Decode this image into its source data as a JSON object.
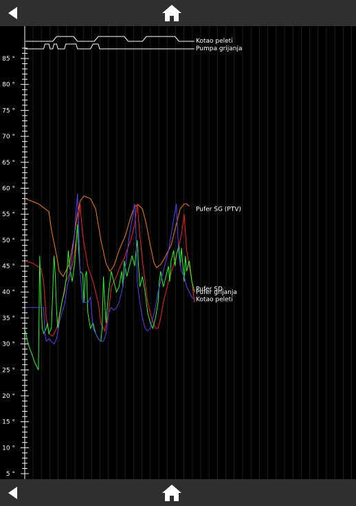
{
  "nav": {
    "back_icon": "back-arrow-icon",
    "home_icon": "home-icon"
  },
  "chart_data": {
    "type": "line",
    "ylim": [
      4,
      90
    ],
    "xlim": [
      0,
      100
    ],
    "yticks": [
      5,
      10,
      15,
      20,
      25,
      30,
      35,
      40,
      45,
      50,
      55,
      60,
      65,
      70,
      75,
      80,
      85
    ],
    "ytick_suffix": " °",
    "grid": "vertical",
    "series": [
      {
        "name": "Pufer SG (PTV)",
        "color": "#ff7f00",
        "label_at": 56,
        "points": [
          [
            0,
            58
          ],
          [
            5,
            57
          ],
          [
            9,
            55.5
          ],
          [
            10,
            52
          ],
          [
            12,
            47
          ],
          [
            13,
            44
          ],
          [
            14.5,
            43
          ],
          [
            15.5,
            44
          ],
          [
            17,
            45.5
          ],
          [
            18.5,
            50
          ],
          [
            20,
            55
          ],
          [
            21,
            57.5
          ],
          [
            22.5,
            58.5
          ],
          [
            25,
            58
          ],
          [
            27,
            56
          ],
          [
            29,
            50
          ],
          [
            31,
            45.5
          ],
          [
            32.5,
            44
          ],
          [
            34,
            45
          ],
          [
            36,
            48
          ],
          [
            38.5,
            51
          ],
          [
            40.5,
            54.5
          ],
          [
            42,
            56.5
          ],
          [
            43.5,
            56.8
          ],
          [
            45,
            56
          ],
          [
            46.5,
            53
          ],
          [
            48,
            49
          ],
          [
            49.5,
            45.5
          ],
          [
            50.5,
            44.7
          ],
          [
            52,
            45.3
          ],
          [
            54,
            47
          ],
          [
            56,
            49
          ],
          [
            58,
            53
          ],
          [
            59.5,
            56
          ],
          [
            61,
            57
          ],
          [
            62,
            57
          ],
          [
            63,
            56.5
          ]
        ]
      },
      {
        "name": "Pufer SD",
        "color": "#ff2020",
        "label_at": 40.6,
        "points": [
          [
            0,
            46
          ],
          [
            3,
            45.5
          ],
          [
            6,
            44.5
          ],
          [
            7,
            42
          ],
          [
            8,
            35
          ],
          [
            9,
            32
          ],
          [
            10.5,
            31.5
          ],
          [
            12,
            33
          ],
          [
            14,
            38
          ],
          [
            15.5,
            42
          ],
          [
            17,
            43.5
          ],
          [
            18.5,
            46
          ],
          [
            20,
            52
          ],
          [
            21,
            57
          ],
          [
            22,
            51
          ],
          [
            23,
            48
          ],
          [
            24,
            45
          ],
          [
            26,
            42
          ],
          [
            28,
            38
          ],
          [
            29,
            34
          ],
          [
            30.5,
            32.5
          ],
          [
            32,
            36
          ],
          [
            33,
            41
          ],
          [
            35,
            43
          ],
          [
            36.5,
            45
          ],
          [
            38,
            46.5
          ],
          [
            39,
            48
          ],
          [
            40.5,
            50
          ],
          [
            42,
            53
          ],
          [
            43,
            57
          ],
          [
            44,
            51
          ],
          [
            45,
            46
          ],
          [
            46,
            42
          ],
          [
            47,
            38
          ],
          [
            48.5,
            35
          ],
          [
            50,
            33
          ],
          [
            51,
            33
          ],
          [
            52,
            35
          ],
          [
            53,
            38
          ],
          [
            55,
            42
          ],
          [
            56.5,
            44.5
          ],
          [
            58,
            47
          ],
          [
            59,
            49
          ],
          [
            60,
            51
          ],
          [
            61,
            55
          ],
          [
            62,
            48
          ],
          [
            63,
            45
          ],
          [
            64,
            42
          ],
          [
            65,
            38
          ]
        ]
      },
      {
        "name": "Pufer grijanja",
        "color": "#20ff20",
        "label_at": 40,
        "points": [
          [
            0,
            32.5
          ],
          [
            1,
            30
          ],
          [
            2.5,
            28
          ],
          [
            3.5,
            26.5
          ],
          [
            5,
            25
          ],
          [
            5.5,
            47
          ],
          [
            6,
            38
          ],
          [
            6.5,
            33
          ],
          [
            7,
            32
          ],
          [
            8,
            33
          ],
          [
            8.5,
            34
          ],
          [
            9,
            32
          ],
          [
            10,
            33
          ],
          [
            10.5,
            40
          ],
          [
            11,
            47
          ],
          [
            11.5,
            43
          ],
          [
            12,
            36
          ],
          [
            12.5,
            33
          ],
          [
            13,
            35
          ],
          [
            14,
            38
          ],
          [
            15,
            40
          ],
          [
            16,
            44
          ],
          [
            16.5,
            48
          ],
          [
            17,
            45
          ],
          [
            18,
            42
          ],
          [
            19,
            46
          ],
          [
            20,
            53
          ],
          [
            20.5,
            48
          ],
          [
            21,
            44
          ],
          [
            22,
            43.5
          ],
          [
            22.5,
            38
          ],
          [
            23,
            43
          ],
          [
            23.5,
            44
          ],
          [
            24,
            36
          ],
          [
            25,
            33
          ],
          [
            26,
            34
          ],
          [
            27,
            32
          ],
          [
            28,
            31
          ],
          [
            29,
            30.5
          ],
          [
            29.5,
            33
          ],
          [
            30,
            43
          ],
          [
            30.5,
            38
          ],
          [
            31,
            34
          ],
          [
            32,
            40
          ],
          [
            33,
            44
          ],
          [
            34,
            42
          ],
          [
            35,
            40
          ],
          [
            36,
            41
          ],
          [
            37,
            44
          ],
          [
            37.5,
            41
          ],
          [
            38,
            46
          ],
          [
            39,
            43
          ],
          [
            40,
            45
          ],
          [
            41,
            47
          ],
          [
            42,
            45
          ],
          [
            43,
            50
          ],
          [
            43.5,
            45
          ],
          [
            44,
            41
          ],
          [
            45,
            43
          ],
          [
            46,
            40
          ],
          [
            47,
            36
          ],
          [
            48,
            34
          ],
          [
            49,
            33
          ],
          [
            50,
            35
          ],
          [
            51,
            38
          ],
          [
            51.5,
            42
          ],
          [
            52,
            44
          ],
          [
            53,
            41
          ],
          [
            54,
            43
          ],
          [
            55,
            45
          ],
          [
            55.5,
            42
          ],
          [
            56,
            46
          ],
          [
            57,
            48
          ],
          [
            57.5,
            45
          ],
          [
            58,
            47
          ],
          [
            59,
            49
          ],
          [
            59.5,
            45
          ],
          [
            60,
            48.5
          ],
          [
            61,
            42
          ],
          [
            61.5,
            47
          ],
          [
            62,
            44
          ],
          [
            63,
            46
          ],
          [
            64,
            42
          ],
          [
            65,
            40
          ]
        ]
      },
      {
        "name": "Kotao peleti",
        "color": "#5540ff",
        "label_at": 38.6,
        "points": [
          [
            0,
            37
          ],
          [
            7,
            37
          ],
          [
            7.5,
            32
          ],
          [
            8,
            30.5
          ],
          [
            9,
            31
          ],
          [
            10,
            30.5
          ],
          [
            11,
            30
          ],
          [
            12,
            31
          ],
          [
            13,
            34
          ],
          [
            14,
            36
          ],
          [
            15,
            37.5
          ],
          [
            16,
            41
          ],
          [
            17,
            43
          ],
          [
            18,
            47
          ],
          [
            19,
            52
          ],
          [
            20,
            59
          ],
          [
            20.5,
            52
          ],
          [
            21,
            44
          ],
          [
            22,
            38
          ],
          [
            23,
            38
          ],
          [
            24,
            38
          ],
          [
            25,
            39
          ],
          [
            26,
            33
          ],
          [
            27,
            32
          ],
          [
            28,
            31
          ],
          [
            29,
            30.5
          ],
          [
            30,
            30.5
          ],
          [
            31,
            32
          ],
          [
            32,
            36
          ],
          [
            33,
            37
          ],
          [
            34,
            36.5
          ],
          [
            35,
            37
          ],
          [
            36,
            38
          ],
          [
            37,
            40
          ],
          [
            38,
            43
          ],
          [
            39,
            47
          ],
          [
            40,
            51
          ],
          [
            41,
            54
          ],
          [
            42,
            57
          ],
          [
            42.5,
            52
          ],
          [
            43,
            42
          ],
          [
            44,
            38
          ],
          [
            45,
            35
          ],
          [
            46,
            33
          ],
          [
            47,
            32.5
          ],
          [
            48,
            33
          ],
          [
            49,
            35
          ],
          [
            50,
            37
          ],
          [
            51,
            40
          ],
          [
            52,
            42
          ],
          [
            53,
            44
          ],
          [
            54,
            46
          ],
          [
            55,
            48
          ],
          [
            56,
            51
          ],
          [
            57,
            54
          ],
          [
            58,
            57
          ],
          [
            58.5,
            52
          ],
          [
            59,
            47
          ],
          [
            60,
            44
          ],
          [
            61,
            43
          ],
          [
            62,
            41
          ],
          [
            63,
            40
          ],
          [
            64,
            39
          ],
          [
            65,
            38.6
          ]
        ]
      }
    ],
    "digital_series": [
      {
        "name": "Kotao peleti",
        "color": "#ffffff",
        "transitions": [
          [
            0,
            0
          ],
          [
            10.5,
            0
          ],
          [
            12,
            1
          ],
          [
            18.5,
            1
          ],
          [
            20,
            0
          ],
          [
            26.5,
            0
          ],
          [
            28,
            1
          ],
          [
            38,
            1
          ],
          [
            39.5,
            0
          ],
          [
            45,
            0
          ],
          [
            46.5,
            1
          ],
          [
            57.5,
            1
          ],
          [
            59,
            0
          ],
          [
            65,
            0
          ]
        ]
      },
      {
        "name": "Pumpa grijanja",
        "color": "#ffffff",
        "transitions": [
          [
            0,
            0
          ],
          [
            7,
            0
          ],
          [
            7.5,
            1
          ],
          [
            9,
            1
          ],
          [
            9.5,
            0
          ],
          [
            10.5,
            0
          ],
          [
            11,
            1
          ],
          [
            12,
            1
          ],
          [
            12.5,
            0
          ],
          [
            15,
            0
          ],
          [
            15.5,
            1
          ],
          [
            19.5,
            1
          ],
          [
            20,
            0
          ],
          [
            25,
            0
          ],
          [
            26,
            1
          ],
          [
            28,
            1
          ],
          [
            28.5,
            0
          ],
          [
            65,
            0
          ]
        ]
      }
    ]
  }
}
